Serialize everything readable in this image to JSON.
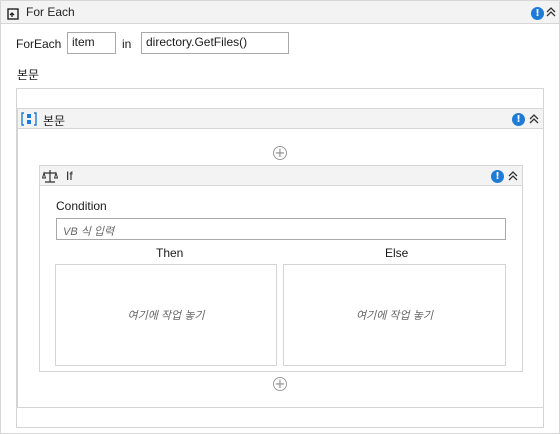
{
  "foreach": {
    "title": "For Each",
    "label_foreach": "ForEach",
    "item_value": "item",
    "label_in": "in",
    "collection_value": "directory.GetFiles()",
    "body_label": "본문"
  },
  "sequence": {
    "title": "본문"
  },
  "if_activity": {
    "title": "If",
    "condition_label": "Condition",
    "condition_placeholder": "VB 식 입력",
    "then_label": "Then",
    "else_label": "Else",
    "then_drop": "여기에 작업 놓기",
    "else_drop": "여기에 작업 놓기"
  },
  "icons": {
    "warning": "!",
    "collapse": "⌃",
    "add": "+"
  },
  "colors": {
    "warning_blue": "#1e7bd6",
    "header_bg": "#f3f3f3"
  }
}
